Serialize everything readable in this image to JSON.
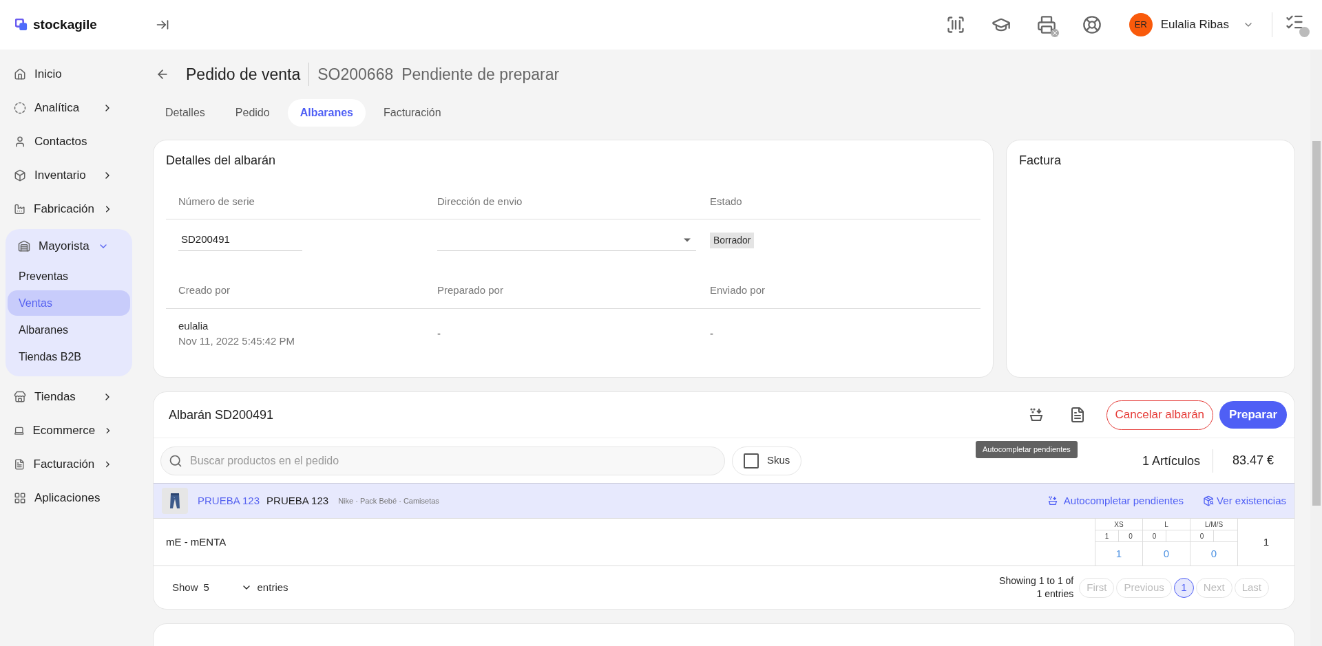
{
  "header": {
    "logo": "stockagile",
    "user": {
      "initials": "ER",
      "name": "Eulalia Ribas"
    }
  },
  "sidebar": {
    "items": [
      {
        "kind": "home",
        "label": "Inicio",
        "arrow": false
      },
      {
        "kind": "chart",
        "label": "Analítica",
        "arrow": true
      },
      {
        "kind": "user",
        "label": "Contactos",
        "arrow": false
      },
      {
        "kind": "box",
        "label": "Inventario",
        "arrow": true
      },
      {
        "kind": "factory",
        "label": "Fabricación",
        "arrow": true
      },
      {
        "kind": "warehouse",
        "label": "Mayorista",
        "arrow": true,
        "expanded": true,
        "children": [
          {
            "label": "Preventas",
            "selected": false
          },
          {
            "label": "Ventas",
            "selected": true
          },
          {
            "label": "Albaranes",
            "selected": false
          },
          {
            "label": "Tiendas B2B",
            "selected": false
          }
        ]
      },
      {
        "kind": "store",
        "label": "Tiendas",
        "arrow": true
      },
      {
        "kind": "laptop",
        "label": "Ecommerce",
        "arrow": true
      },
      {
        "kind": "invoice",
        "label": "Facturación",
        "arrow": true
      },
      {
        "kind": "apps",
        "label": "Aplicaciones",
        "arrow": false
      }
    ]
  },
  "page": {
    "title": "Pedido de venta",
    "order": "SO200668",
    "status": "Pendiente de preparar"
  },
  "tabs": [
    {
      "label": "Detalles",
      "selected": false
    },
    {
      "label": "Pedido",
      "selected": false
    },
    {
      "label": "Albaranes",
      "selected": true
    },
    {
      "label": "Facturación",
      "selected": false
    }
  ],
  "details": {
    "title": "Detalles del albarán",
    "labels_1": [
      "Número de serie",
      "Dirección de envio",
      "Estado"
    ],
    "serial": "SD200491",
    "status_badge": "Borrador",
    "labels_2": [
      "Creado por",
      "Preparado por",
      "Enviado por"
    ],
    "created_by": "eulalia",
    "created_at": "Nov 11, 2022 5:45:42 PM",
    "prepared_by": "-",
    "sent_by": "-"
  },
  "invoice": {
    "title": "Factura"
  },
  "albaran": {
    "title": "Albarán SD200491",
    "tooltip": "Autocompletar pendientes",
    "cancel": "Cancelar albarán",
    "prepare": "Preparar",
    "search": {
      "placeholder": "Buscar productos en el pedido"
    },
    "skus": {
      "label": "Skus",
      "checked": false
    },
    "articles": "1 Artículos",
    "total": "83.47 €",
    "product": {
      "code": "PRUEBA 123",
      "name": "PRUEBA 123",
      "meta": "Nike · Pack Bebé · Camisetas",
      "autocomplete": "Autocompletar pendientes",
      "stock": "Ver existencias"
    },
    "variant": {
      "name": "mE - mENTA",
      "sizes": [
        {
          "label": "XS",
          "sub": [
            "1",
            "0"
          ],
          "qty": "1"
        },
        {
          "label": "L",
          "sub": [
            "0"
          ],
          "qty": "0"
        },
        {
          "label": "L/M/S",
          "sub": [
            "0"
          ],
          "qty": "0"
        }
      ],
      "total": "1"
    },
    "pagination": {
      "show": "Show",
      "page_size": "5",
      "entries": "entries",
      "info": "Showing 1 to 1 of 1 entries",
      "buttons": [
        {
          "label": "First",
          "selected": false
        },
        {
          "label": "Previous",
          "selected": false
        },
        {
          "label": "1",
          "selected": true
        },
        {
          "label": "Next",
          "selected": false
        },
        {
          "label": "Last",
          "selected": false
        }
      ]
    }
  }
}
